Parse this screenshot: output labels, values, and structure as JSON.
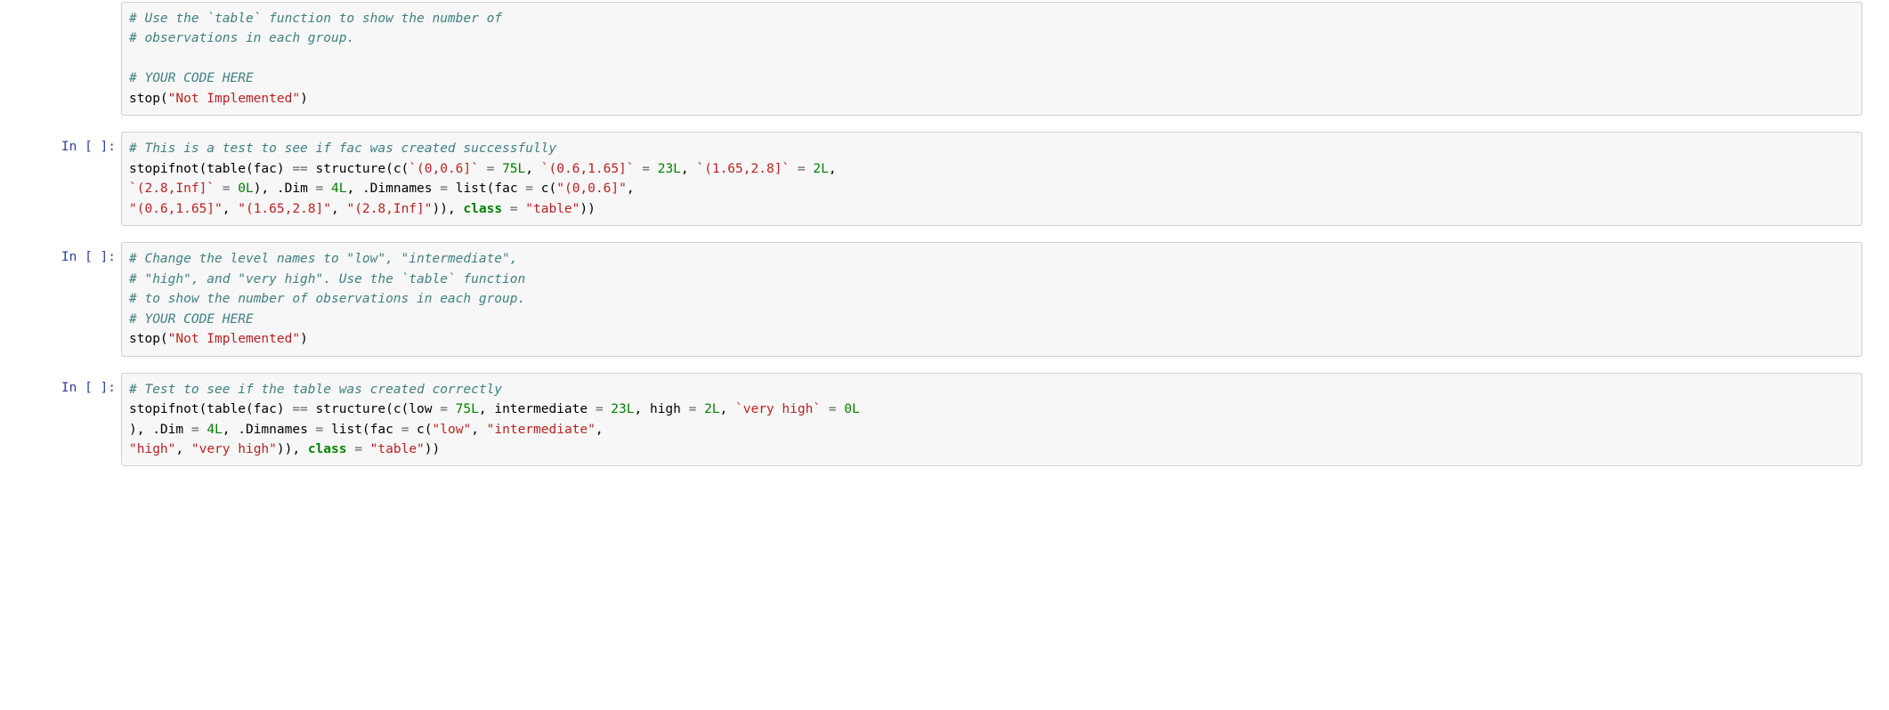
{
  "prompt_label": "In [ ]:",
  "cells": {
    "c0": {
      "tokens": [
        {
          "cls": "c-comment",
          "t": "# Use the `table` function to show the number of"
        },
        {
          "br": true
        },
        {
          "cls": "c-comment",
          "t": "# observations in each group."
        },
        {
          "br": true
        },
        {
          "br": true
        },
        {
          "cls": "c-comment",
          "t": "# YOUR CODE HERE"
        },
        {
          "br": true
        },
        {
          "cls": "c-plain",
          "t": "stop("
        },
        {
          "cls": "c-string",
          "t": "\"Not Implemented\""
        },
        {
          "cls": "c-plain",
          "t": ")"
        }
      ]
    },
    "c1": {
      "tokens": [
        {
          "cls": "c-comment",
          "t": "# This is a test to see if fac was created successfully"
        },
        {
          "br": true
        },
        {
          "cls": "c-plain",
          "t": "stopifnot(table(fac) "
        },
        {
          "cls": "c-op",
          "t": "=="
        },
        {
          "cls": "c-plain",
          "t": " structure(c("
        },
        {
          "cls": "c-string",
          "t": "`(0,0.6]`"
        },
        {
          "cls": "c-plain",
          "t": " "
        },
        {
          "cls": "c-op",
          "t": "="
        },
        {
          "cls": "c-plain",
          "t": " "
        },
        {
          "cls": "c-number",
          "t": "75L"
        },
        {
          "cls": "c-plain",
          "t": ", "
        },
        {
          "cls": "c-string",
          "t": "`(0.6,1.65]`"
        },
        {
          "cls": "c-plain",
          "t": " "
        },
        {
          "cls": "c-op",
          "t": "="
        },
        {
          "cls": "c-plain",
          "t": " "
        },
        {
          "cls": "c-number",
          "t": "23L"
        },
        {
          "cls": "c-plain",
          "t": ", "
        },
        {
          "cls": "c-string",
          "t": "`(1.65,2.8]`"
        },
        {
          "cls": "c-plain",
          "t": " "
        },
        {
          "cls": "c-op",
          "t": "="
        },
        {
          "cls": "c-plain",
          "t": " "
        },
        {
          "cls": "c-number",
          "t": "2L"
        },
        {
          "cls": "c-plain",
          "t": ", "
        },
        {
          "br": true
        },
        {
          "cls": "c-string",
          "t": "`(2.8,Inf]`"
        },
        {
          "cls": "c-plain",
          "t": " "
        },
        {
          "cls": "c-op",
          "t": "="
        },
        {
          "cls": "c-plain",
          "t": " "
        },
        {
          "cls": "c-number",
          "t": "0L"
        },
        {
          "cls": "c-plain",
          "t": "), .Dim "
        },
        {
          "cls": "c-op",
          "t": "="
        },
        {
          "cls": "c-plain",
          "t": " "
        },
        {
          "cls": "c-number",
          "t": "4L"
        },
        {
          "cls": "c-plain",
          "t": ", .Dimnames "
        },
        {
          "cls": "c-op",
          "t": "="
        },
        {
          "cls": "c-plain",
          "t": " list(fac "
        },
        {
          "cls": "c-op",
          "t": "="
        },
        {
          "cls": "c-plain",
          "t": " c("
        },
        {
          "cls": "c-string",
          "t": "\"(0,0.6]\""
        },
        {
          "cls": "c-plain",
          "t": ", "
        },
        {
          "br": true
        },
        {
          "cls": "c-string",
          "t": "\"(0.6,1.65]\""
        },
        {
          "cls": "c-plain",
          "t": ", "
        },
        {
          "cls": "c-string",
          "t": "\"(1.65,2.8]\""
        },
        {
          "cls": "c-plain",
          "t": ", "
        },
        {
          "cls": "c-string",
          "t": "\"(2.8,Inf]\""
        },
        {
          "cls": "c-plain",
          "t": ")), "
        },
        {
          "cls": "c-keyword",
          "t": "class"
        },
        {
          "cls": "c-plain",
          "t": " "
        },
        {
          "cls": "c-op",
          "t": "="
        },
        {
          "cls": "c-plain",
          "t": " "
        },
        {
          "cls": "c-string",
          "t": "\"table\""
        },
        {
          "cls": "c-plain",
          "t": "))"
        }
      ]
    },
    "c2": {
      "tokens": [
        {
          "cls": "c-comment",
          "t": "# Change the level names to \"low\", \"intermediate\","
        },
        {
          "br": true
        },
        {
          "cls": "c-comment",
          "t": "# \"high\", and \"very high\". Use the `table` function"
        },
        {
          "br": true
        },
        {
          "cls": "c-comment",
          "t": "# to show the number of observations in each group."
        },
        {
          "br": true
        },
        {
          "cls": "c-comment",
          "t": "# YOUR CODE HERE"
        },
        {
          "br": true
        },
        {
          "cls": "c-plain",
          "t": "stop("
        },
        {
          "cls": "c-string",
          "t": "\"Not Implemented\""
        },
        {
          "cls": "c-plain",
          "t": ")"
        }
      ]
    },
    "c3": {
      "tokens": [
        {
          "cls": "c-comment",
          "t": "# Test to see if the table was created correctly"
        },
        {
          "br": true
        },
        {
          "cls": "c-plain",
          "t": "stopifnot(table(fac) "
        },
        {
          "cls": "c-op",
          "t": "=="
        },
        {
          "cls": "c-plain",
          "t": " structure(c(low "
        },
        {
          "cls": "c-op",
          "t": "="
        },
        {
          "cls": "c-plain",
          "t": " "
        },
        {
          "cls": "c-number",
          "t": "75L"
        },
        {
          "cls": "c-plain",
          "t": ", intermediate "
        },
        {
          "cls": "c-op",
          "t": "="
        },
        {
          "cls": "c-plain",
          "t": " "
        },
        {
          "cls": "c-number",
          "t": "23L"
        },
        {
          "cls": "c-plain",
          "t": ", high "
        },
        {
          "cls": "c-op",
          "t": "="
        },
        {
          "cls": "c-plain",
          "t": " "
        },
        {
          "cls": "c-number",
          "t": "2L"
        },
        {
          "cls": "c-plain",
          "t": ", "
        },
        {
          "cls": "c-string",
          "t": "`very high`"
        },
        {
          "cls": "c-plain",
          "t": " "
        },
        {
          "cls": "c-op",
          "t": "="
        },
        {
          "cls": "c-plain",
          "t": " "
        },
        {
          "cls": "c-number",
          "t": "0L"
        },
        {
          "br": true
        },
        {
          "cls": "c-plain",
          "t": "), .Dim "
        },
        {
          "cls": "c-op",
          "t": "="
        },
        {
          "cls": "c-plain",
          "t": " "
        },
        {
          "cls": "c-number",
          "t": "4L"
        },
        {
          "cls": "c-plain",
          "t": ", .Dimnames "
        },
        {
          "cls": "c-op",
          "t": "="
        },
        {
          "cls": "c-plain",
          "t": " list(fac "
        },
        {
          "cls": "c-op",
          "t": "="
        },
        {
          "cls": "c-plain",
          "t": " c("
        },
        {
          "cls": "c-string",
          "t": "\"low\""
        },
        {
          "cls": "c-plain",
          "t": ", "
        },
        {
          "cls": "c-string",
          "t": "\"intermediate\""
        },
        {
          "cls": "c-plain",
          "t": ", "
        },
        {
          "br": true
        },
        {
          "cls": "c-string",
          "t": "\"high\""
        },
        {
          "cls": "c-plain",
          "t": ", "
        },
        {
          "cls": "c-string",
          "t": "\"very high\""
        },
        {
          "cls": "c-plain",
          "t": ")), "
        },
        {
          "cls": "c-keyword",
          "t": "class"
        },
        {
          "cls": "c-plain",
          "t": " "
        },
        {
          "cls": "c-op",
          "t": "="
        },
        {
          "cls": "c-plain",
          "t": " "
        },
        {
          "cls": "c-string",
          "t": "\"table\""
        },
        {
          "cls": "c-plain",
          "t": "))"
        }
      ]
    }
  }
}
